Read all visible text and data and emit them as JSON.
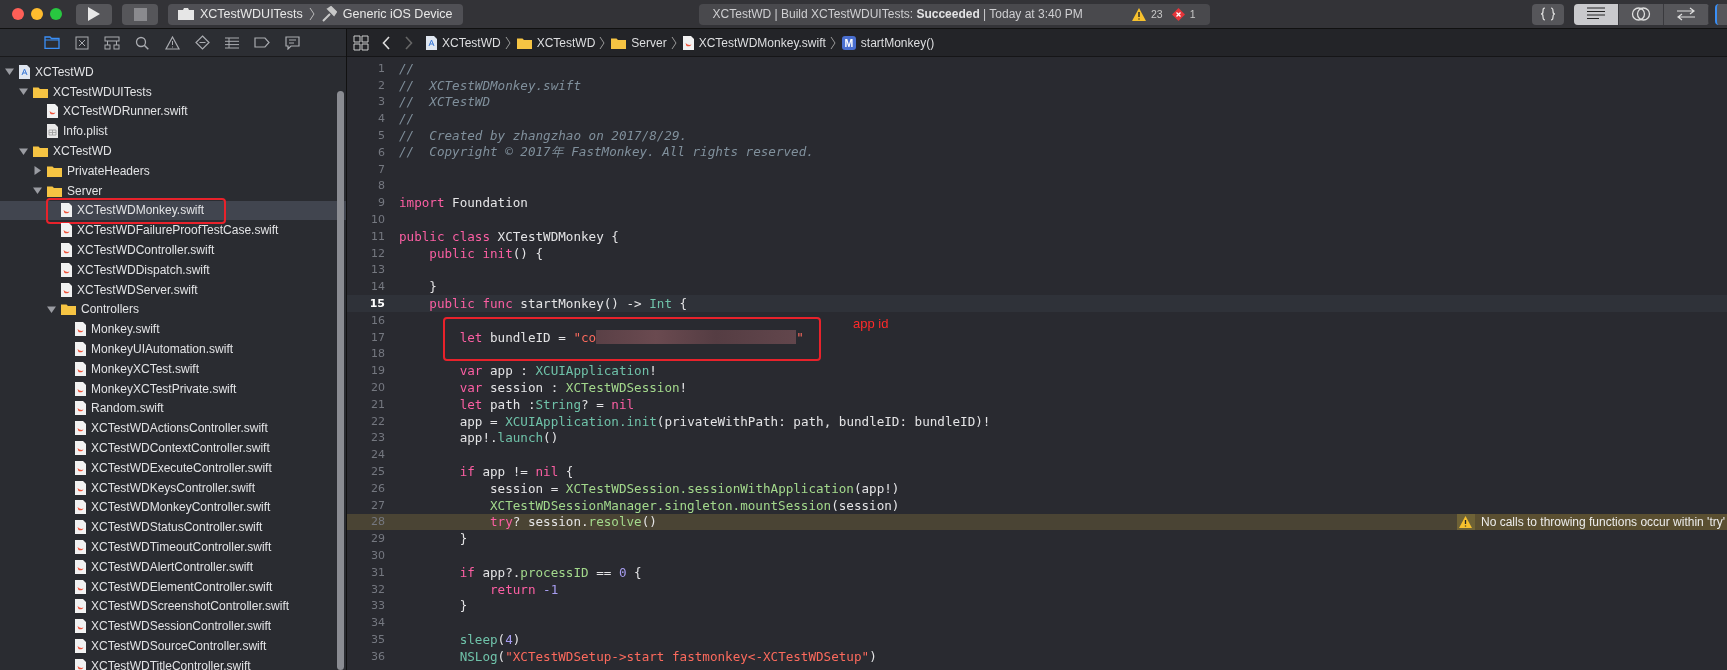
{
  "toolbar": {
    "scheme": "XCTestWDUITests",
    "destination": "Generic iOS Device",
    "activity": "XCTestWD | Build XCTestWDUITests: **Succeeded** | Today at 3:40 PM",
    "warnings": "23",
    "errors": "1",
    "editor_modes": [
      {
        "selected": true
      },
      {
        "selected": false
      },
      {
        "selected": false
      }
    ]
  },
  "navigator": {
    "tabs": [
      {
        "selected": true
      },
      {
        "selected": false
      },
      {
        "selected": false
      },
      {
        "selected": false
      },
      {
        "selected": false
      },
      {
        "selected": false
      },
      {
        "selected": false
      },
      {
        "selected": false
      },
      {
        "selected": false
      }
    ],
    "tree": [
      {
        "name": "XCTestWD",
        "kind": "project",
        "expanded": true,
        "selected": false,
        "children": [
          {
            "name": "XCTestWDUITests",
            "kind": "folder",
            "expanded": true,
            "selected": false,
            "children": [
              {
                "name": "XCTestWDRunner.swift",
                "kind": "swift",
                "selected": false
              },
              {
                "name": "Info.plist",
                "kind": "plist",
                "selected": false
              }
            ]
          },
          {
            "name": "XCTestWD",
            "kind": "folder",
            "expanded": true,
            "selected": false,
            "children": [
              {
                "name": "PrivateHeaders",
                "kind": "folder",
                "expanded": false,
                "selected": false
              },
              {
                "name": "Server",
                "kind": "folder",
                "expanded": true,
                "selected": false,
                "children": [
                  {
                    "name": "XCTestWDMonkey.swift",
                    "kind": "swift",
                    "selected": true,
                    "annotated": true
                  },
                  {
                    "name": "XCTestWDFailureProofTestCase.swift",
                    "kind": "swift",
                    "selected": false
                  },
                  {
                    "name": "XCTestWDController.swift",
                    "kind": "swift",
                    "selected": false
                  },
                  {
                    "name": "XCTestWDDispatch.swift",
                    "kind": "swift",
                    "selected": false
                  },
                  {
                    "name": "XCTestWDServer.swift",
                    "kind": "swift",
                    "selected": false
                  },
                  {
                    "name": "Controllers",
                    "kind": "folder",
                    "expanded": true,
                    "selected": false,
                    "children": [
                      {
                        "name": "Monkey.swift",
                        "kind": "swift",
                        "selected": false
                      },
                      {
                        "name": "MonkeyUIAutomation.swift",
                        "kind": "swift",
                        "selected": false
                      },
                      {
                        "name": "MonkeyXCTest.swift",
                        "kind": "swift",
                        "selected": false
                      },
                      {
                        "name": "MonkeyXCTestPrivate.swift",
                        "kind": "swift",
                        "selected": false
                      },
                      {
                        "name": "Random.swift",
                        "kind": "swift",
                        "selected": false
                      },
                      {
                        "name": "XCTestWDActionsController.swift",
                        "kind": "swift",
                        "selected": false
                      },
                      {
                        "name": "XCTestWDContextController.swift",
                        "kind": "swift",
                        "selected": false
                      },
                      {
                        "name": "XCTestWDExecuteController.swift",
                        "kind": "swift",
                        "selected": false
                      },
                      {
                        "name": "XCTestWDKeysController.swift",
                        "kind": "swift",
                        "selected": false
                      },
                      {
                        "name": "XCTestWDMonkeyController.swift",
                        "kind": "swift",
                        "selected": false
                      },
                      {
                        "name": "XCTestWDStatusController.swift",
                        "kind": "swift",
                        "selected": false
                      },
                      {
                        "name": "XCTestWDTimeoutController.swift",
                        "kind": "swift",
                        "selected": false
                      },
                      {
                        "name": "XCTestWDAlertController.swift",
                        "kind": "swift",
                        "selected": false
                      },
                      {
                        "name": "XCTestWDElementController.swift",
                        "kind": "swift",
                        "selected": false
                      },
                      {
                        "name": "XCTestWDScreenshotController.swift",
                        "kind": "swift",
                        "selected": false
                      },
                      {
                        "name": "XCTestWDSessionController.swift",
                        "kind": "swift",
                        "selected": false
                      },
                      {
                        "name": "XCTestWDSourceController.swift",
                        "kind": "swift",
                        "selected": false
                      },
                      {
                        "name": "XCTestWDTitleController.swift",
                        "kind": "swift",
                        "selected": false
                      }
                    ]
                  }
                ]
              }
            ]
          }
        ]
      }
    ]
  },
  "jump_bar": [
    {
      "kind": "project",
      "label": "XCTestWD"
    },
    {
      "kind": "folder",
      "label": "XCTestWD"
    },
    {
      "kind": "folder",
      "label": "Server"
    },
    {
      "kind": "swift",
      "label": "XCTestWDMonkey.swift"
    },
    {
      "kind": "method",
      "symbol": "M",
      "label": "startMonkey()"
    }
  ],
  "editor": {
    "annotation_label": "app id",
    "lines": [
      {
        "number": "1",
        "current": false,
        "tokens": [
          {
            "kind": "comment",
            "text": "//"
          }
        ]
      },
      {
        "number": "2",
        "current": false,
        "tokens": [
          {
            "kind": "comment",
            "text": "//  XCTestWDMonkey.swift"
          }
        ]
      },
      {
        "number": "3",
        "current": false,
        "tokens": [
          {
            "kind": "comment",
            "text": "//  XCTestWD"
          }
        ]
      },
      {
        "number": "4",
        "current": false,
        "tokens": [
          {
            "kind": "comment",
            "text": "//"
          }
        ]
      },
      {
        "number": "5",
        "current": false,
        "tokens": [
          {
            "kind": "comment",
            "text": "//  Created by zhangzhao on 2017/8/29."
          }
        ]
      },
      {
        "number": "6",
        "current": false,
        "tokens": [
          {
            "kind": "comment",
            "text": "//  Copyright © 2017年 FastMonkey. All rights reserved."
          }
        ]
      },
      {
        "number": "7",
        "current": false
      },
      {
        "number": "8",
        "current": false
      },
      {
        "number": "9",
        "current": false,
        "tokens": [
          {
            "kind": "keyword",
            "text": "import"
          },
          {
            "kind": "plain",
            "text": " Foundation"
          }
        ]
      },
      {
        "number": "10",
        "current": false
      },
      {
        "number": "11",
        "current": false,
        "tokens": [
          {
            "kind": "keyword",
            "text": "public class"
          },
          {
            "kind": "plain",
            "text": " XCTestWDMonkey {"
          }
        ]
      },
      {
        "number": "12",
        "current": false,
        "tokens": [
          {
            "kind": "keyword",
            "text": "    public init"
          },
          {
            "kind": "plain",
            "text": "() {"
          }
        ]
      },
      {
        "number": "13",
        "current": false
      },
      {
        "number": "14",
        "current": false,
        "tokens": [
          {
            "kind": "plain",
            "text": "    }"
          }
        ]
      },
      {
        "number": "15",
        "current": true,
        "tokens": [
          {
            "kind": "keyword",
            "text": "    public func"
          },
          {
            "kind": "plain",
            "text": " startMonkey() -> "
          },
          {
            "kind": "system",
            "text": "Int"
          },
          {
            "kind": "plain",
            "text": " {"
          }
        ]
      },
      {
        "number": "16",
        "current": false
      },
      {
        "number": "17",
        "current": false,
        "annotated": true,
        "tokens": [
          {
            "kind": "keyword",
            "text": "        let"
          },
          {
            "kind": "plain",
            "text": " bundleID = "
          },
          {
            "kind": "string",
            "text": "\"co"
          },
          {
            "kind": "redacted"
          },
          {
            "kind": "string",
            "text": "\""
          }
        ]
      },
      {
        "number": "18",
        "current": false
      },
      {
        "number": "19",
        "current": false,
        "tokens": [
          {
            "kind": "keyword",
            "text": "        var"
          },
          {
            "kind": "plain",
            "text": " app : "
          },
          {
            "kind": "system",
            "text": "XCUIApplication"
          },
          {
            "kind": "plain",
            "text": "!"
          }
        ]
      },
      {
        "number": "20",
        "current": false,
        "tokens": [
          {
            "kind": "keyword",
            "text": "        var"
          },
          {
            "kind": "plain",
            "text": " session : "
          },
          {
            "kind": "project",
            "text": "XCTestWDSession"
          },
          {
            "kind": "plain",
            "text": "!"
          }
        ]
      },
      {
        "number": "21",
        "current": false,
        "tokens": [
          {
            "kind": "keyword",
            "text": "        let"
          },
          {
            "kind": "plain",
            "text": " path :"
          },
          {
            "kind": "system",
            "text": "String"
          },
          {
            "kind": "plain",
            "text": "? = "
          },
          {
            "kind": "keyword",
            "text": "nil"
          }
        ]
      },
      {
        "number": "22",
        "current": false,
        "tokens": [
          {
            "kind": "plain",
            "text": "        app = "
          },
          {
            "kind": "system",
            "text": "XCUIApplication."
          },
          {
            "kind": "system",
            "text": "init"
          },
          {
            "kind": "plain",
            "text": "(privateWithPath: path, bundleID: bundleID)!"
          }
        ]
      },
      {
        "number": "23",
        "current": false,
        "tokens": [
          {
            "kind": "plain",
            "text": "        app!."
          },
          {
            "kind": "system",
            "text": "launch"
          },
          {
            "kind": "plain",
            "text": "()"
          }
        ]
      },
      {
        "number": "24",
        "current": false
      },
      {
        "number": "25",
        "current": false,
        "tokens": [
          {
            "kind": "keyword",
            "text": "        if"
          },
          {
            "kind": "plain",
            "text": " app != "
          },
          {
            "kind": "keyword",
            "text": "nil"
          },
          {
            "kind": "plain",
            "text": " {"
          }
        ]
      },
      {
        "number": "26",
        "current": false,
        "tokens": [
          {
            "kind": "plain",
            "text": "            session = "
          },
          {
            "kind": "project",
            "text": "XCTestWDSession."
          },
          {
            "kind": "project",
            "text": "sessionWithApplication"
          },
          {
            "kind": "plain",
            "text": "(app!)"
          }
        ]
      },
      {
        "number": "27",
        "current": false,
        "tokens": [
          {
            "kind": "project",
            "text": "            XCTestWDSessionManager.singleton.mountSession"
          },
          {
            "kind": "plain",
            "text": "(session)"
          }
        ]
      },
      {
        "number": "28",
        "current": false,
        "warning": "No calls to throwing functions occur within 'try'",
        "tokens": [
          {
            "kind": "keyword",
            "text": "            try"
          },
          {
            "kind": "plain",
            "text": "? session."
          },
          {
            "kind": "project",
            "text": "resolve"
          },
          {
            "kind": "plain",
            "text": "()"
          }
        ]
      },
      {
        "number": "29",
        "current": false,
        "tokens": [
          {
            "kind": "plain",
            "text": "        }"
          }
        ]
      },
      {
        "number": "30",
        "current": false
      },
      {
        "number": "31",
        "current": false,
        "tokens": [
          {
            "kind": "keyword",
            "text": "        if"
          },
          {
            "kind": "plain",
            "text": " app?."
          },
          {
            "kind": "project",
            "text": "processID"
          },
          {
            "kind": "plain",
            "text": " == "
          },
          {
            "kind": "number",
            "text": "0"
          },
          {
            "kind": "plain",
            "text": " {"
          }
        ]
      },
      {
        "number": "32",
        "current": false,
        "tokens": [
          {
            "kind": "keyword",
            "text": "            return "
          },
          {
            "kind": "number",
            "text": "-1"
          }
        ]
      },
      {
        "number": "33",
        "current": false,
        "tokens": [
          {
            "kind": "plain",
            "text": "        }"
          }
        ]
      },
      {
        "number": "34",
        "current": false
      },
      {
        "number": "35",
        "current": false,
        "tokens": [
          {
            "kind": "system",
            "text": "        sleep"
          },
          {
            "kind": "plain",
            "text": "("
          },
          {
            "kind": "number",
            "text": "4"
          },
          {
            "kind": "plain",
            "text": ")"
          }
        ]
      },
      {
        "number": "36",
        "current": false,
        "tokens": [
          {
            "kind": "system",
            "text": "        NSLog"
          },
          {
            "kind": "plain",
            "text": "("
          },
          {
            "kind": "string",
            "text": "\"XCTestWDSetup->start fastmonkey<-XCTestWDSetup\""
          },
          {
            "kind": "plain",
            "text": ")"
          }
        ]
      }
    ]
  }
}
